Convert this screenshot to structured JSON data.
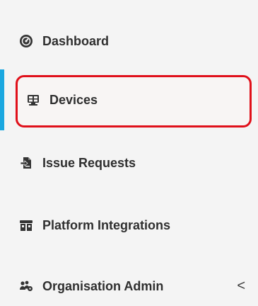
{
  "nav": {
    "items": [
      {
        "label": "Dashboard",
        "icon": "dashboard-icon"
      },
      {
        "label": "Devices",
        "icon": "devices-icon",
        "active": true
      },
      {
        "label": "Issue Requests",
        "icon": "issue-requests-icon"
      },
      {
        "label": "Platform Integrations",
        "icon": "platform-integrations-icon"
      },
      {
        "label": "Organisation Admin",
        "icon": "organisation-admin-icon",
        "chevron": "<"
      }
    ]
  },
  "colors": {
    "accent": "#1aa7e0",
    "highlight_border": "#e0101a",
    "text": "#2f2f2f",
    "background": "#f4f4f4"
  }
}
